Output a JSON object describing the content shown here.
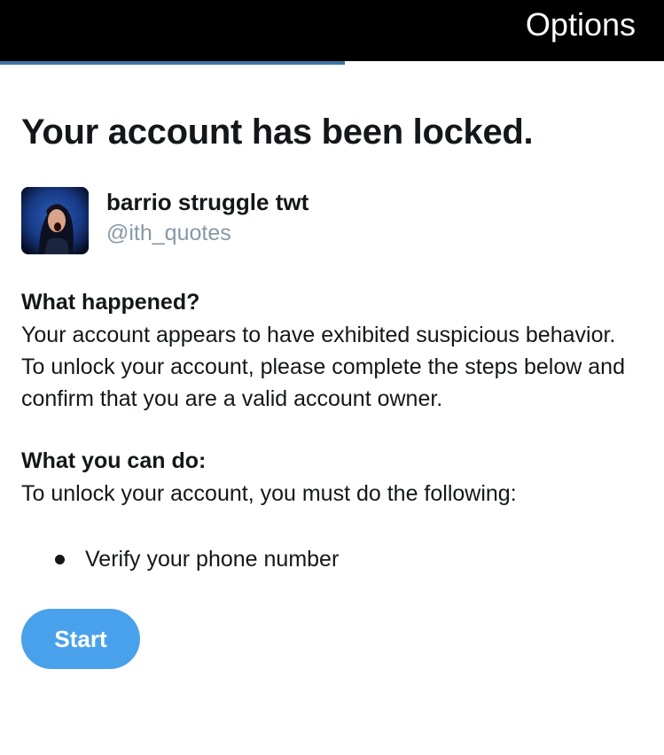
{
  "header": {
    "options_label": "Options",
    "progress": 0.52
  },
  "page": {
    "title": "Your account has been locked."
  },
  "account": {
    "name": "barrio struggle twt",
    "handle": "@ith_quotes"
  },
  "what_happened": {
    "heading": "What happened?",
    "text": "Your account appears to have exhibited suspicious behavior. To unlock your account, please complete the steps below and confirm that you are a valid account owner."
  },
  "what_you_can_do": {
    "heading": "What you can do:",
    "text": "To unlock your account, you must do the following:",
    "steps": [
      "Verify your phone number"
    ]
  },
  "actions": {
    "start_label": "Start"
  },
  "colors": {
    "topbar": "#000000",
    "progress": "#3f74a3",
    "button": "#4aa1eb",
    "handle": "#8899a6"
  }
}
